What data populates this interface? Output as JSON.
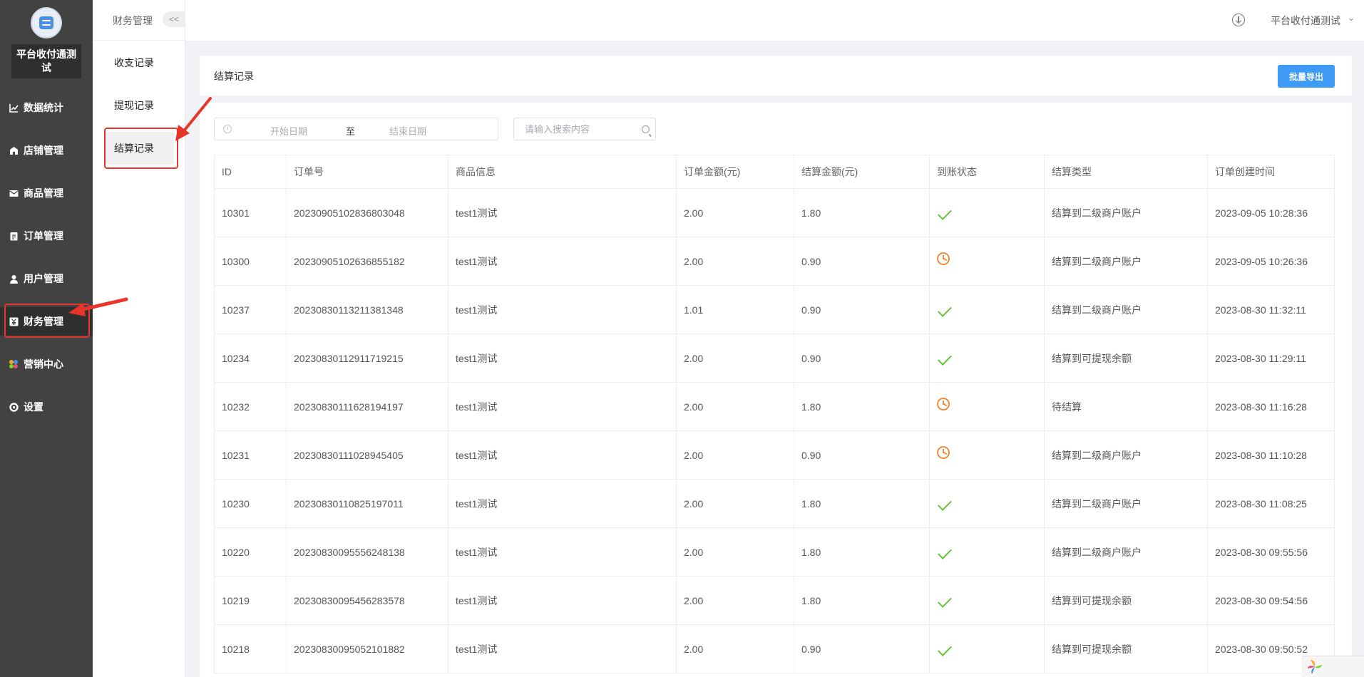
{
  "app": {
    "brand": "平台收付通测试"
  },
  "sidebar": {
    "items": [
      {
        "label": "数据统计",
        "icon": "chart-line-icon"
      },
      {
        "label": "店铺管理",
        "icon": "store-icon"
      },
      {
        "label": "商品管理",
        "icon": "mail-icon"
      },
      {
        "label": "订单管理",
        "icon": "clipboard-icon"
      },
      {
        "label": "用户管理",
        "icon": "user-icon"
      },
      {
        "label": "财务管理",
        "icon": "yen-wallet-icon",
        "active": true
      },
      {
        "label": "营销中心",
        "icon": "colorful-grid-icon"
      },
      {
        "label": "设置",
        "icon": "gear-icon"
      }
    ]
  },
  "subnav": {
    "title": "财务管理",
    "collapse_label": "<<",
    "items": [
      {
        "label": "收支记录"
      },
      {
        "label": "提现记录"
      },
      {
        "label": "结算记录",
        "active": true
      }
    ]
  },
  "header": {
    "user": "平台收付通测试",
    "download_icon": "download-circle-icon",
    "dropdown_icon": "chevron-down-icon"
  },
  "page": {
    "title": "结算记录",
    "export_label": "批量导出"
  },
  "filters": {
    "start_placeholder": "开始日期",
    "separator": "至",
    "end_placeholder": "结束日期",
    "search_placeholder": "请输入搜索内容"
  },
  "table": {
    "columns": [
      "ID",
      "订单号",
      "商品信息",
      "订单金额(元)",
      "结算金额(元)",
      "到账状态",
      "结算类型",
      "订单创建时间"
    ],
    "rows": [
      {
        "id": "10301",
        "order_no": "20230905102836803048",
        "product": "test1测试",
        "order_amount": "2.00",
        "settle_amount": "1.80",
        "status": "done",
        "type": "结算到二级商户账户",
        "created": "2023-09-05 10:28:36"
      },
      {
        "id": "10300",
        "order_no": "20230905102636855182",
        "product": "test1测试",
        "order_amount": "2.00",
        "settle_amount": "0.90",
        "status": "pending",
        "type": "结算到二级商户账户",
        "created": "2023-09-05 10:26:36"
      },
      {
        "id": "10237",
        "order_no": "20230830113211381348",
        "product": "test1测试",
        "order_amount": "1.01",
        "settle_amount": "0.90",
        "status": "done",
        "type": "结算到二级商户账户",
        "created": "2023-08-30 11:32:11"
      },
      {
        "id": "10234",
        "order_no": "20230830112911719215",
        "product": "test1测试",
        "order_amount": "2.00",
        "settle_amount": "0.90",
        "status": "done",
        "type": "结算到可提现余额",
        "created": "2023-08-30 11:29:11"
      },
      {
        "id": "10232",
        "order_no": "20230830111628194197",
        "product": "test1测试",
        "order_amount": "2.00",
        "settle_amount": "1.80",
        "status": "pending",
        "type": "待结算",
        "created": "2023-08-30 11:16:28"
      },
      {
        "id": "10231",
        "order_no": "20230830111028945405",
        "product": "test1测试",
        "order_amount": "2.00",
        "settle_amount": "0.90",
        "status": "pending",
        "type": "结算到二级商户账户",
        "created": "2023-08-30 11:10:28"
      },
      {
        "id": "10230",
        "order_no": "20230830110825197011",
        "product": "test1测试",
        "order_amount": "2.00",
        "settle_amount": "1.80",
        "status": "done",
        "type": "结算到二级商户账户",
        "created": "2023-08-30 11:08:25"
      },
      {
        "id": "10220",
        "order_no": "20230830095556248138",
        "product": "test1测试",
        "order_amount": "2.00",
        "settle_amount": "1.80",
        "status": "done",
        "type": "结算到二级商户账户",
        "created": "2023-08-30 09:55:56"
      },
      {
        "id": "10219",
        "order_no": "20230830095456283578",
        "product": "test1测试",
        "order_amount": "2.00",
        "settle_amount": "1.80",
        "status": "done",
        "type": "结算到可提现余额",
        "created": "2023-08-30 09:54:56"
      },
      {
        "id": "10218",
        "order_no": "20230830095052101882",
        "product": "test1测试",
        "order_amount": "2.00",
        "settle_amount": "0.90",
        "status": "done",
        "type": "结算到可提现余额",
        "created": "2023-08-30 09:50:52"
      }
    ]
  },
  "status_icons": {
    "done": "check-icon",
    "pending": "clock-icon"
  },
  "colors": {
    "accent": "#3d9bf5",
    "ok": "#67c23a",
    "pending": "#f08c3e",
    "annotation": "#e8352b",
    "sidebar": "#424242"
  }
}
